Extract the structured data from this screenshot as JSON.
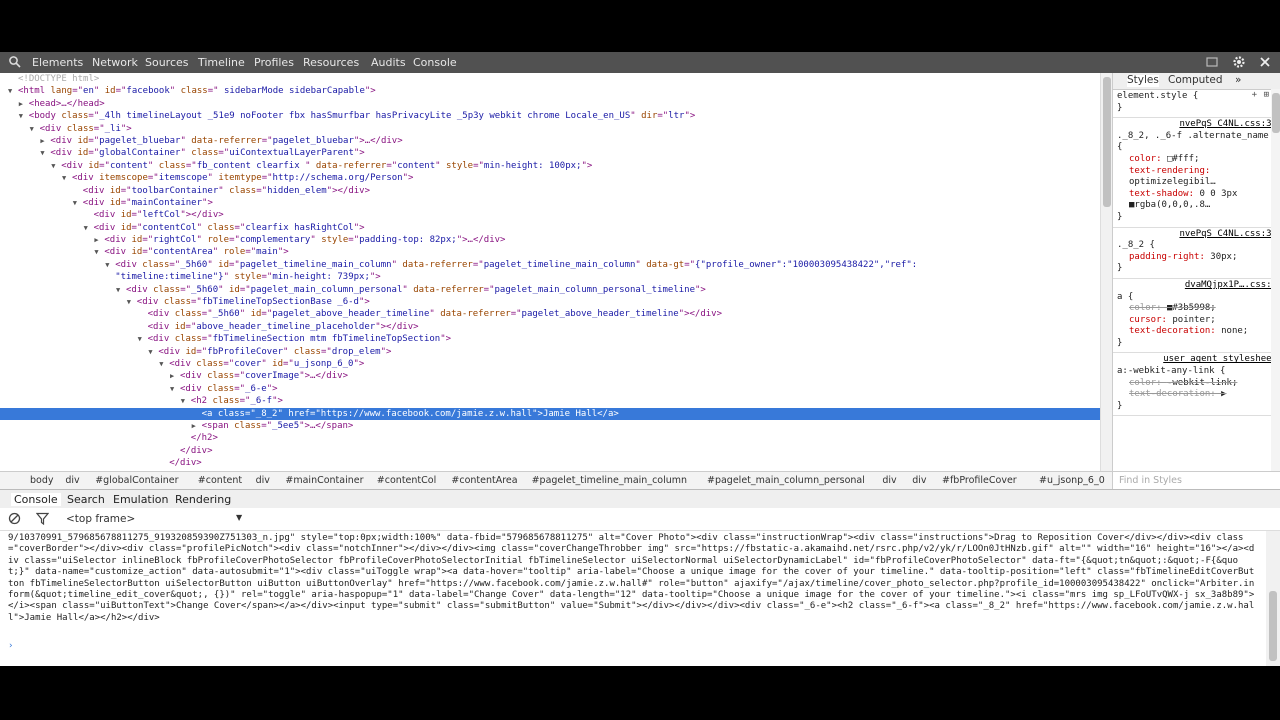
{
  "toolbar": {
    "tabs": [
      "Elements",
      "Network",
      "Sources",
      "Timeline",
      "Profiles",
      "Resources",
      "Audits",
      "Console"
    ]
  },
  "tree": {
    "lines": [
      {
        "depth": 0,
        "tri": "",
        "html": "<span class='cm'>&lt;!DOCTYPE html&gt;</span>"
      },
      {
        "depth": 0,
        "tri": "▼",
        "html": "&lt;html <span class='an'>lang</span>=\"<span class='av'>en</span>\" <span class='an'>id</span>=\"<span class='av'>facebook</span>\" <span class='an'>class</span>=\"<span class='av'> sidebarMode sidebarCapable</span>\"&gt;"
      },
      {
        "depth": 1,
        "tri": "▶",
        "html": "&lt;head&gt;…&lt;/head&gt;"
      },
      {
        "depth": 1,
        "tri": "▼",
        "html": "&lt;body <span class='an'>class</span>=\"<span class='av'>_4lh timelineLayout _51e9 noFooter fbx hasSmurfbar hasPrivacyLite _5p3y webkit chrome Locale_en_US</span>\" <span class='an'>dir</span>=\"<span class='av'>ltr</span>\"&gt;"
      },
      {
        "depth": 2,
        "tri": "▼",
        "html": "&lt;div <span class='an'>class</span>=\"<span class='av'>_li</span>\"&gt;"
      },
      {
        "depth": 3,
        "tri": "▶",
        "html": "&lt;div <span class='an'>id</span>=\"<span class='av'>pagelet_bluebar</span>\" <span class='an'>data-referrer</span>=\"<span class='av'>pagelet_bluebar</span>\"&gt;…&lt;/div&gt;"
      },
      {
        "depth": 3,
        "tri": "▼",
        "html": "&lt;div <span class='an'>id</span>=\"<span class='av'>globalContainer</span>\" <span class='an'>class</span>=\"<span class='av'>uiContextualLayerParent</span>\"&gt;"
      },
      {
        "depth": 4,
        "tri": "▼",
        "html": "&lt;div <span class='an'>id</span>=\"<span class='av'>content</span>\" <span class='an'>class</span>=\"<span class='av'>fb_content clearfix </span>\" <span class='an'>data-referrer</span>=\"<span class='av'>content</span>\" <span class='an'>style</span>=\"<span class='av'>min-height: 100px;</span>\"&gt;"
      },
      {
        "depth": 5,
        "tri": "▼",
        "html": "&lt;div <span class='an'>itemscope</span>=\"<span class='av'>itemscope</span>\" <span class='an'>itemtype</span>=\"<span class='av'>http://schema.org/Person</span>\"&gt;"
      },
      {
        "depth": 6,
        "tri": "",
        "html": "&lt;div <span class='an'>id</span>=\"<span class='av'>toolbarContainer</span>\" <span class='an'>class</span>=\"<span class='av'>hidden_elem</span>\"&gt;&lt;/div&gt;"
      },
      {
        "depth": 6,
        "tri": "▼",
        "html": "&lt;div <span class='an'>id</span>=\"<span class='av'>mainContainer</span>\"&gt;"
      },
      {
        "depth": 7,
        "tri": "",
        "html": "&lt;div <span class='an'>id</span>=\"<span class='av'>leftCol</span>\"&gt;&lt;/div&gt;"
      },
      {
        "depth": 7,
        "tri": "▼",
        "html": "&lt;div <span class='an'>id</span>=\"<span class='av'>contentCol</span>\" <span class='an'>class</span>=\"<span class='av'>clearfix hasRightCol</span>\"&gt;"
      },
      {
        "depth": 8,
        "tri": "▶",
        "html": "&lt;div <span class='an'>id</span>=\"<span class='av'>rightCol</span>\" <span class='an'>role</span>=\"<span class='av'>complementary</span>\" <span class='an'>style</span>=\"<span class='av'>padding-top: 82px;</span>\"&gt;…&lt;/div&gt;"
      },
      {
        "depth": 8,
        "tri": "▼",
        "html": "&lt;div <span class='an'>id</span>=\"<span class='av'>contentArea</span>\" <span class='an'>role</span>=\"<span class='av'>main</span>\"&gt;"
      },
      {
        "depth": 9,
        "tri": "▼",
        "html": "&lt;div <span class='an'>class</span>=\"<span class='av'>_5h60</span>\" <span class='an'>id</span>=\"<span class='av'>pagelet_timeline_main_column</span>\" <span class='an'>data-referrer</span>=\"<span class='av'>pagelet_timeline_main_column</span>\" <span class='an'>data-gt</span>=\"<span class='av'>{\"profile_owner\":\"100003095438422\",\"ref\":</span>"
      },
      {
        "depth": 9,
        "tri": "",
        "html": "<span class='av'>\"timeline:timeline\"}</span>\" <span class='an'>style</span>=\"<span class='av'>min-height: 739px;</span>\"&gt;"
      },
      {
        "depth": 10,
        "tri": "▼",
        "html": "&lt;div <span class='an'>class</span>=\"<span class='av'>_5h60</span>\" <span class='an'>id</span>=\"<span class='av'>pagelet_main_column_personal</span>\" <span class='an'>data-referrer</span>=\"<span class='av'>pagelet_main_column_personal_timeline</span>\"&gt;"
      },
      {
        "depth": 11,
        "tri": "▼",
        "html": "&lt;div <span class='an'>class</span>=\"<span class='av'>fbTimelineTopSectionBase _6-d</span>\"&gt;"
      },
      {
        "depth": 12,
        "tri": "",
        "html": "&lt;div <span class='an'>class</span>=\"<span class='av'>_5h60</span>\" <span class='an'>id</span>=\"<span class='av'>pagelet_above_header_timeline</span>\" <span class='an'>data-referrer</span>=\"<span class='av'>pagelet_above_header_timeline</span>\"&gt;&lt;/div&gt;"
      },
      {
        "depth": 12,
        "tri": "",
        "html": "&lt;div <span class='an'>id</span>=\"<span class='av'>above_header_timeline_placeholder</span>\"&gt;&lt;/div&gt;"
      },
      {
        "depth": 12,
        "tri": "▼",
        "html": "&lt;div <span class='an'>class</span>=\"<span class='av'>fbTimelineSection mtm fbTimelineTopSection</span>\"&gt;"
      },
      {
        "depth": 13,
        "tri": "▼",
        "html": "&lt;div <span class='an'>id</span>=\"<span class='av'>fbProfileCover</span>\" <span class='an'>class</span>=\"<span class='av'>drop_elem</span>\"&gt;"
      },
      {
        "depth": 14,
        "tri": "▼",
        "html": "&lt;div <span class='an'>class</span>=\"<span class='av'>cover</span>\" <span class='an'>id</span>=\"<span class='av'>u_jsonp_6_0</span>\"&gt;"
      },
      {
        "depth": 15,
        "tri": "▶",
        "html": "&lt;div <span class='an'>class</span>=\"<span class='av'>coverImage</span>\"&gt;…&lt;/div&gt;"
      },
      {
        "depth": 15,
        "tri": "▼",
        "html": "&lt;div <span class='an'>class</span>=\"<span class='av'>_6-e</span>\"&gt;"
      },
      {
        "depth": 16,
        "tri": "▼",
        "html": "&lt;h2 <span class='an'>class</span>=\"<span class='av'>_6-f</span>\"&gt;"
      },
      {
        "depth": 17,
        "tri": "",
        "sel": true,
        "html": "&lt;a class=\"_8_2\" href=\"https://www.facebook.com/jamie.z.w.hall\"&gt;Jamie Hall&lt;/a&gt;"
      },
      {
        "depth": 17,
        "tri": "▶",
        "html": "&lt;span <span class='an'>class</span>=\"<span class='av'>_5ee5</span>\"&gt;…&lt;/span&gt;"
      },
      {
        "depth": 16,
        "tri": "",
        "html": "&lt;/h2&gt;"
      },
      {
        "depth": 15,
        "tri": "",
        "html": "&lt;/div&gt;"
      },
      {
        "depth": 14,
        "tri": "",
        "html": "&lt;/div&gt;"
      }
    ]
  },
  "styles": {
    "tabs": [
      "Styles",
      "Computed",
      "»"
    ],
    "element_style": "element.style {",
    "rules": [
      {
        "source": "nvePqS_C4NL.css:32",
        "selector": "._8_2, ._6-f .alternate_name {",
        "props": [
          {
            "n": "color:",
            "v": "□#fff;"
          },
          {
            "n": "text-rendering:",
            "v": "optimizelegibil…"
          },
          {
            "n": "text-shadow:",
            "v": "0 0 3px ■rgba(0,0,0,.8…"
          }
        ]
      },
      {
        "source": "nvePqS_C4NL.css:32",
        "selector": "._8_2 {",
        "props": [
          {
            "n": "padding-right:",
            "v": "30px;"
          }
        ]
      },
      {
        "source": "dvaMQjpx1P….css:6",
        "selector": "a {",
        "props": [
          {
            "n": "color:",
            "v": "■#3b5998;",
            "strike": true
          },
          {
            "n": "cursor:",
            "v": "pointer;"
          },
          {
            "n": "text-decoration:",
            "v": "none;"
          }
        ]
      },
      {
        "source": "user agent stylesheet",
        "selector": "a:-webkit-any-link {",
        "props": [
          {
            "n": "color:",
            "v": "-webkit-link;",
            "strike": true
          },
          {
            "n": "text-decoration:",
            "v": "▶",
            "strike": true
          }
        ]
      }
    ]
  },
  "breadcrumbs": [
    "body",
    "div",
    "#globalContainer",
    "#content",
    "div",
    "#mainContainer",
    "#contentCol",
    "#contentArea",
    "#pagelet_timeline_main_column",
    "#pagelet_main_column_personal",
    "div",
    "div",
    "#fbProfileCover",
    "#u_jsonp_6_0",
    "div",
    "h2",
    "a._8_2"
  ],
  "find_placeholder": "Find in Styles",
  "drawer": {
    "tabs": [
      "Console",
      "Search",
      "Emulation",
      "Rendering"
    ],
    "frame": "<top frame>",
    "output": "9/10370991_579685678811275_919320859390Z751303_n.jpg\" style=\"top:0px;width:100%\" data-fbid=\"579685678811275\" alt=\"Cover Photo\"><div class=\"instructionWrap\"><div class=\"instructions\">Drag to Reposition Cover</div></div><div class=\"coverBorder\"></div><div class=\"profilePicNotch\"><div class=\"notchInner\"></div></div><img class=\"coverChangeThrobber img\" src=\"https://fbstatic-a.akamaihd.net/rsrc.php/v2/yk/r/LOOn0JtHNzb.gif\" alt=\"\" width=\"16\" height=\"16\"></a><div class=\"uiSelector inlineBlock fbProfileCoverPhotoSelector fbProfileCoverPhotoSelectorInitial fbTimelineSelector uiSelectorNormal uiSelectorDynamicLabel\" id=\"fbProfileCoverPhotoSelector\" data-ft=\"{&quot;tn&quot;:&quot;-F{&quot;}\" data-name=\"customize_action\" data-autosubmit=\"1\"><div class=\"uiToggle wrap\"><a data-hover=\"tooltip\" aria-label=\"Choose a unique image for the cover of your timeline.\" data-tooltip-position=\"left\" class=\"fbTimelineEditCoverButton fbTimelineSelectorButton uiSelectorButton uiButton uiButtonOverlay\" href=\"https://www.facebook.com/jamie.z.w.hall#\" role=\"button\" ajaxify=\"/ajax/timeline/cover_photo_selector.php?profile_id=100003095438422\" onclick=\"Arbiter.inform(&quot;timeline_edit_cover&quot;, {})\" rel=\"toggle\" aria-haspopup=\"1\" data-label=\"Change Cover\" data-length=\"12\" data-tooltip=\"Choose a unique image for the cover of your timeline.\"><i class=\"mrs img sp_LFoUTvQWX-j sx_3a8b89\"></i><span class=\"uiButtonText\">Change Cover</span></a></div><input type=\"submit\" class=\"submitButton\" value=\"Submit\"></div></div></div><div class=\"_6-e\"><h2 class=\"_6-f\"><a class=\"_8_2\" href=\"https://www.facebook.com/jamie.z.w.hall\">Jamie Hall</a></h2></div>",
    "prompt": "›"
  }
}
